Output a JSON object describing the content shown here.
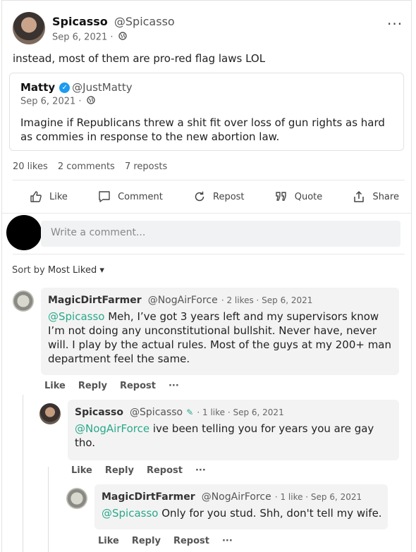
{
  "post": {
    "author_name": "Spicasso",
    "author_handle": "@Spicasso",
    "date": "Sep 6, 2021 ·",
    "more": "···",
    "text": "instead, most of them are pro-red flag laws LOL"
  },
  "quote": {
    "author_name": "Matty",
    "verified": "✓",
    "author_handle": "@JustMatty",
    "date": "Sep 6, 2021 ·",
    "text": "Imagine if Republicans threw a shit fit over loss of gun rights as hard as commies in response to the new abortion law."
  },
  "stats": {
    "likes": "20 likes",
    "comments": "2 comments",
    "reposts": "7 reposts"
  },
  "actions": {
    "like": "Like",
    "comment": "Comment",
    "repost": "Repost",
    "quote": "Quote",
    "share": "Share"
  },
  "composer": {
    "placeholder": "Write a comment..."
  },
  "sort": {
    "label": "Sort by",
    "value": "Most Liked ▾"
  },
  "comments": [
    {
      "name": "MagicDirtFarmer",
      "handle": "@NogAirForce",
      "meta": "· 2 likes · Sep 6, 2021",
      "mention": "@Spicasso",
      "text": " Meh, I’ve got 3 years left and my supervisors know I’m not doing any unconstitutional bullshit. Never have, never will. I play by the actual rules. Most of the guys at my 200+ man department feel the same.",
      "actions": [
        "Like",
        "Reply",
        "Repost",
        "···"
      ]
    },
    {
      "name": "Spicasso",
      "handle": "@Spicasso",
      "pen": "✎",
      "meta": "· 1 like · Sep 6, 2021",
      "mention": "@NogAirForce",
      "text": " ive been telling you for years you are gay tho.",
      "actions": [
        "Like",
        "Reply",
        "Repost",
        "···"
      ]
    },
    {
      "name": "MagicDirtFarmer",
      "handle": "@NogAirForce",
      "meta": "· 1 like · Sep 6, 2021",
      "mention": "@Spicasso",
      "text": " Only for you stud. Shh, don't tell my wife.",
      "actions": [
        "Like",
        "Reply",
        "Repost",
        "···"
      ]
    }
  ],
  "colors": {
    "mention": "#2aa88a",
    "verified": "#1d9bf0",
    "bubble": "#f3f3f3"
  },
  "icons": [
    "thumbs-up-icon",
    "comment-icon",
    "repost-icon",
    "quote-icon",
    "share-icon",
    "more-icon",
    "globe-icon",
    "verified-icon",
    "pen-icon"
  ]
}
